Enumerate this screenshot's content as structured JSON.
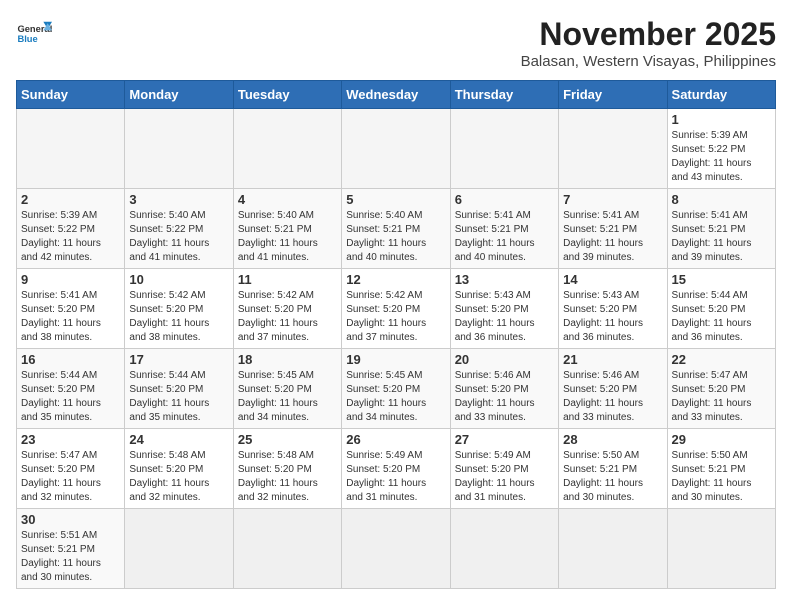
{
  "header": {
    "logo_line1": "General",
    "logo_line2": "Blue",
    "month_year": "November 2025",
    "location": "Balasan, Western Visayas, Philippines"
  },
  "weekdays": [
    "Sunday",
    "Monday",
    "Tuesday",
    "Wednesday",
    "Thursday",
    "Friday",
    "Saturday"
  ],
  "weeks": [
    [
      {
        "day": "",
        "info": ""
      },
      {
        "day": "",
        "info": ""
      },
      {
        "day": "",
        "info": ""
      },
      {
        "day": "",
        "info": ""
      },
      {
        "day": "",
        "info": ""
      },
      {
        "day": "",
        "info": ""
      },
      {
        "day": "1",
        "info": "Sunrise: 5:39 AM\nSunset: 5:22 PM\nDaylight: 11 hours\nand 43 minutes."
      }
    ],
    [
      {
        "day": "2",
        "info": "Sunrise: 5:39 AM\nSunset: 5:22 PM\nDaylight: 11 hours\nand 42 minutes."
      },
      {
        "day": "3",
        "info": "Sunrise: 5:40 AM\nSunset: 5:22 PM\nDaylight: 11 hours\nand 41 minutes."
      },
      {
        "day": "4",
        "info": "Sunrise: 5:40 AM\nSunset: 5:21 PM\nDaylight: 11 hours\nand 41 minutes."
      },
      {
        "day": "5",
        "info": "Sunrise: 5:40 AM\nSunset: 5:21 PM\nDaylight: 11 hours\nand 40 minutes."
      },
      {
        "day": "6",
        "info": "Sunrise: 5:41 AM\nSunset: 5:21 PM\nDaylight: 11 hours\nand 40 minutes."
      },
      {
        "day": "7",
        "info": "Sunrise: 5:41 AM\nSunset: 5:21 PM\nDaylight: 11 hours\nand 39 minutes."
      },
      {
        "day": "8",
        "info": "Sunrise: 5:41 AM\nSunset: 5:21 PM\nDaylight: 11 hours\nand 39 minutes."
      }
    ],
    [
      {
        "day": "9",
        "info": "Sunrise: 5:41 AM\nSunset: 5:20 PM\nDaylight: 11 hours\nand 38 minutes."
      },
      {
        "day": "10",
        "info": "Sunrise: 5:42 AM\nSunset: 5:20 PM\nDaylight: 11 hours\nand 38 minutes."
      },
      {
        "day": "11",
        "info": "Sunrise: 5:42 AM\nSunset: 5:20 PM\nDaylight: 11 hours\nand 37 minutes."
      },
      {
        "day": "12",
        "info": "Sunrise: 5:42 AM\nSunset: 5:20 PM\nDaylight: 11 hours\nand 37 minutes."
      },
      {
        "day": "13",
        "info": "Sunrise: 5:43 AM\nSunset: 5:20 PM\nDaylight: 11 hours\nand 36 minutes."
      },
      {
        "day": "14",
        "info": "Sunrise: 5:43 AM\nSunset: 5:20 PM\nDaylight: 11 hours\nand 36 minutes."
      },
      {
        "day": "15",
        "info": "Sunrise: 5:44 AM\nSunset: 5:20 PM\nDaylight: 11 hours\nand 36 minutes."
      }
    ],
    [
      {
        "day": "16",
        "info": "Sunrise: 5:44 AM\nSunset: 5:20 PM\nDaylight: 11 hours\nand 35 minutes."
      },
      {
        "day": "17",
        "info": "Sunrise: 5:44 AM\nSunset: 5:20 PM\nDaylight: 11 hours\nand 35 minutes."
      },
      {
        "day": "18",
        "info": "Sunrise: 5:45 AM\nSunset: 5:20 PM\nDaylight: 11 hours\nand 34 minutes."
      },
      {
        "day": "19",
        "info": "Sunrise: 5:45 AM\nSunset: 5:20 PM\nDaylight: 11 hours\nand 34 minutes."
      },
      {
        "day": "20",
        "info": "Sunrise: 5:46 AM\nSunset: 5:20 PM\nDaylight: 11 hours\nand 33 minutes."
      },
      {
        "day": "21",
        "info": "Sunrise: 5:46 AM\nSunset: 5:20 PM\nDaylight: 11 hours\nand 33 minutes."
      },
      {
        "day": "22",
        "info": "Sunrise: 5:47 AM\nSunset: 5:20 PM\nDaylight: 11 hours\nand 33 minutes."
      }
    ],
    [
      {
        "day": "23",
        "info": "Sunrise: 5:47 AM\nSunset: 5:20 PM\nDaylight: 11 hours\nand 32 minutes."
      },
      {
        "day": "24",
        "info": "Sunrise: 5:48 AM\nSunset: 5:20 PM\nDaylight: 11 hours\nand 32 minutes."
      },
      {
        "day": "25",
        "info": "Sunrise: 5:48 AM\nSunset: 5:20 PM\nDaylight: 11 hours\nand 32 minutes."
      },
      {
        "day": "26",
        "info": "Sunrise: 5:49 AM\nSunset: 5:20 PM\nDaylight: 11 hours\nand 31 minutes."
      },
      {
        "day": "27",
        "info": "Sunrise: 5:49 AM\nSunset: 5:20 PM\nDaylight: 11 hours\nand 31 minutes."
      },
      {
        "day": "28",
        "info": "Sunrise: 5:50 AM\nSunset: 5:21 PM\nDaylight: 11 hours\nand 30 minutes."
      },
      {
        "day": "29",
        "info": "Sunrise: 5:50 AM\nSunset: 5:21 PM\nDaylight: 11 hours\nand 30 minutes."
      }
    ],
    [
      {
        "day": "30",
        "info": "Sunrise: 5:51 AM\nSunset: 5:21 PM\nDaylight: 11 hours\nand 30 minutes."
      },
      {
        "day": "",
        "info": ""
      },
      {
        "day": "",
        "info": ""
      },
      {
        "day": "",
        "info": ""
      },
      {
        "day": "",
        "info": ""
      },
      {
        "day": "",
        "info": ""
      },
      {
        "day": "",
        "info": ""
      }
    ]
  ]
}
